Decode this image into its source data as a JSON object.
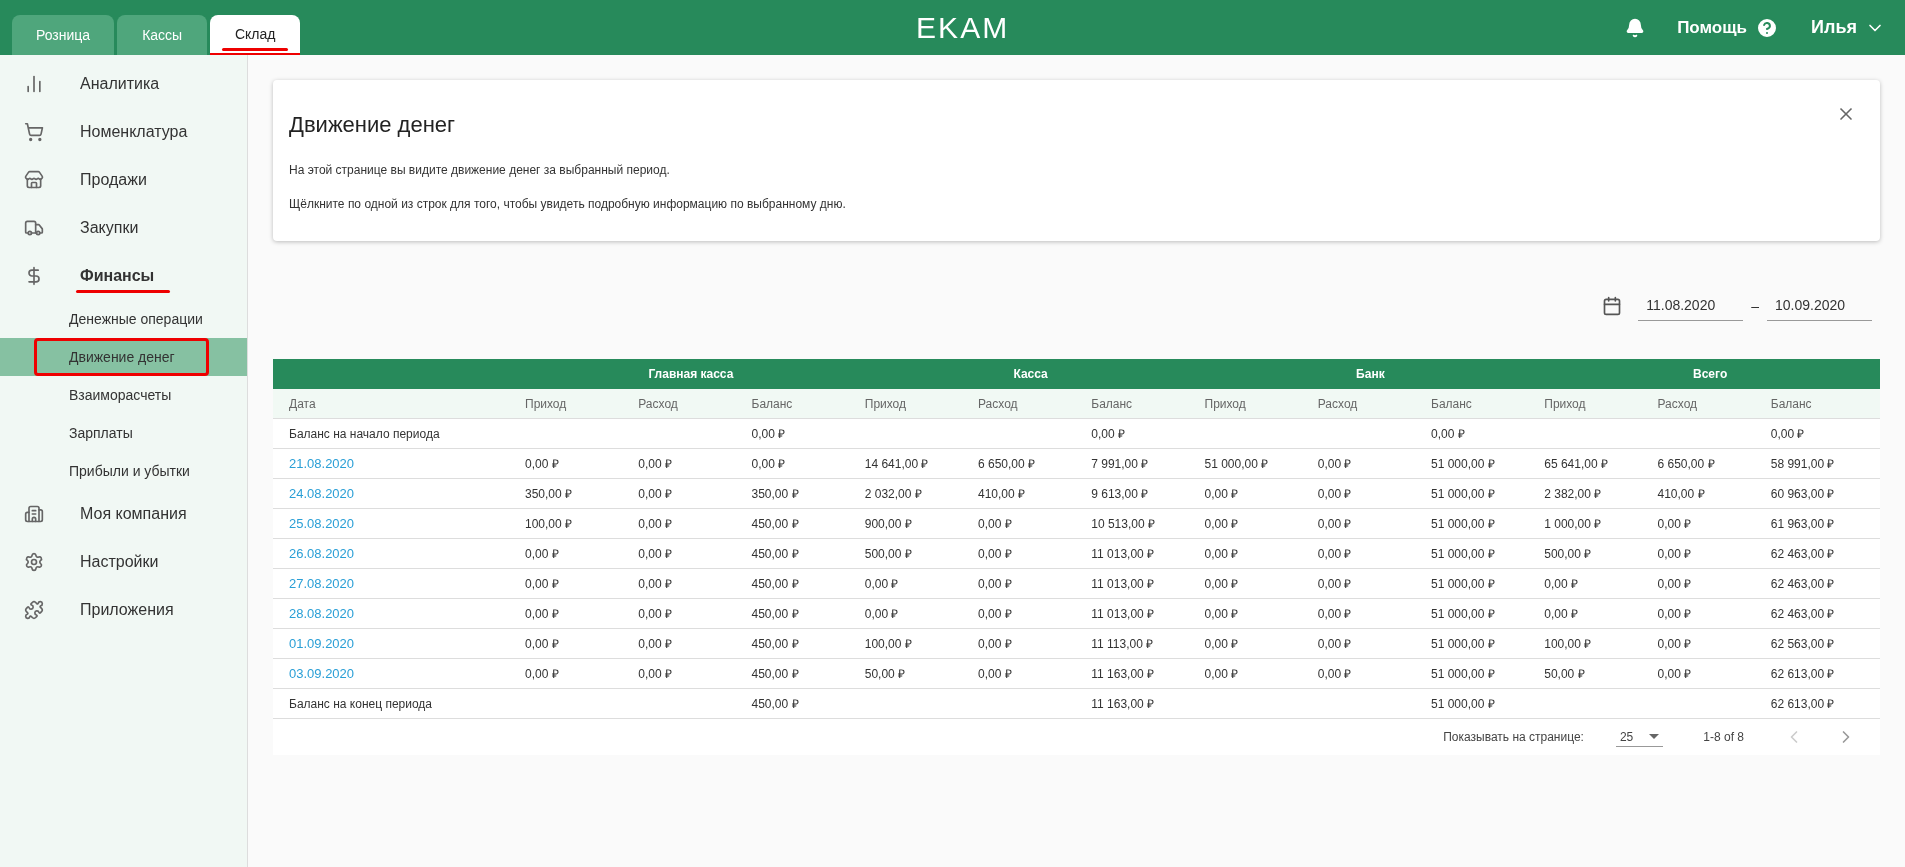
{
  "topbar": {
    "tabs": [
      {
        "label": "Розница",
        "selected": false,
        "annotated": false
      },
      {
        "label": "Кассы",
        "selected": false,
        "annotated": false
      },
      {
        "label": "Склад",
        "selected": true,
        "annotated": true
      }
    ],
    "logo": "EKAM",
    "help": "Помощь",
    "user": "Илья"
  },
  "sidebar": {
    "items": [
      {
        "label": "Аналитика",
        "expanded": false,
        "annotated": false
      },
      {
        "label": "Номенклатура",
        "expanded": false,
        "annotated": false
      },
      {
        "label": "Продажи",
        "expanded": false,
        "annotated": false
      },
      {
        "label": "Закупки",
        "expanded": false,
        "annotated": false
      },
      {
        "label": "Финансы",
        "expanded": true,
        "annotated": true,
        "children": [
          {
            "label": "Денежные операции",
            "selected": false,
            "annotated": false
          },
          {
            "label": "Движение денег",
            "selected": true,
            "annotated": true
          },
          {
            "label": "Взаиморасчеты",
            "selected": false,
            "annotated": false
          },
          {
            "label": "Зарплаты",
            "selected": false,
            "annotated": false
          },
          {
            "label": "Прибыли и убытки",
            "selected": false,
            "annotated": false
          }
        ]
      },
      {
        "label": "Моя компания",
        "expanded": false,
        "annotated": false
      },
      {
        "label": "Настройки",
        "expanded": false,
        "annotated": false
      },
      {
        "label": "Приложения",
        "expanded": false,
        "annotated": false
      }
    ]
  },
  "info_card": {
    "title": "Движение денег",
    "lines": [
      "На этой странице вы видите движение денег за выбранный период.",
      "Щёлкните по одной из строк для того, чтобы увидеть подробную информацию по выбранному дню."
    ]
  },
  "date_range": {
    "from": "11.08.2020",
    "separator": "–",
    "to": "10.09.2020"
  },
  "table": {
    "groups": [
      "Главная касса",
      "Касса",
      "Банк",
      "Всего"
    ],
    "columns": [
      "Дата",
      "Приход",
      "Расход",
      "Баланс",
      "Приход",
      "Расход",
      "Баланс",
      "Приход",
      "Расход",
      "Баланс",
      "Приход",
      "Расход",
      "Баланс"
    ],
    "rows": [
      {
        "kind": "balance",
        "cells": [
          "Баланс на начало периода",
          null,
          null,
          "0,00 ₽",
          null,
          null,
          "0,00 ₽",
          null,
          null,
          "0,00 ₽",
          null,
          null,
          "0,00 ₽"
        ]
      },
      {
        "kind": "day",
        "cells": [
          "21.08.2020",
          "0,00 ₽",
          "0,00 ₽",
          "0,00 ₽",
          "14 641,00 ₽",
          "6 650,00 ₽",
          "7 991,00 ₽",
          "51 000,00 ₽",
          "0,00 ₽",
          "51 000,00 ₽",
          "65 641,00 ₽",
          "6 650,00 ₽",
          "58 991,00 ₽"
        ]
      },
      {
        "kind": "day",
        "cells": [
          "24.08.2020",
          "350,00 ₽",
          "0,00 ₽",
          "350,00 ₽",
          "2 032,00 ₽",
          "410,00 ₽",
          "9 613,00 ₽",
          "0,00 ₽",
          "0,00 ₽",
          "51 000,00 ₽",
          "2 382,00 ₽",
          "410,00 ₽",
          "60 963,00 ₽"
        ]
      },
      {
        "kind": "day",
        "cells": [
          "25.08.2020",
          "100,00 ₽",
          "0,00 ₽",
          "450,00 ₽",
          "900,00 ₽",
          "0,00 ₽",
          "10 513,00 ₽",
          "0,00 ₽",
          "0,00 ₽",
          "51 000,00 ₽",
          "1 000,00 ₽",
          "0,00 ₽",
          "61 963,00 ₽"
        ]
      },
      {
        "kind": "day",
        "cells": [
          "26.08.2020",
          "0,00 ₽",
          "0,00 ₽",
          "450,00 ₽",
          "500,00 ₽",
          "0,00 ₽",
          "11 013,00 ₽",
          "0,00 ₽",
          "0,00 ₽",
          "51 000,00 ₽",
          "500,00 ₽",
          "0,00 ₽",
          "62 463,00 ₽"
        ]
      },
      {
        "kind": "day",
        "cells": [
          "27.08.2020",
          "0,00 ₽",
          "0,00 ₽",
          "450,00 ₽",
          "0,00 ₽",
          "0,00 ₽",
          "11 013,00 ₽",
          "0,00 ₽",
          "0,00 ₽",
          "51 000,00 ₽",
          "0,00 ₽",
          "0,00 ₽",
          "62 463,00 ₽"
        ]
      },
      {
        "kind": "day",
        "cells": [
          "28.08.2020",
          "0,00 ₽",
          "0,00 ₽",
          "450,00 ₽",
          "0,00 ₽",
          "0,00 ₽",
          "11 013,00 ₽",
          "0,00 ₽",
          "0,00 ₽",
          "51 000,00 ₽",
          "0,00 ₽",
          "0,00 ₽",
          "62 463,00 ₽"
        ]
      },
      {
        "kind": "day",
        "cells": [
          "01.09.2020",
          "0,00 ₽",
          "0,00 ₽",
          "450,00 ₽",
          "100,00 ₽",
          "0,00 ₽",
          "11 113,00 ₽",
          "0,00 ₽",
          "0,00 ₽",
          "51 000,00 ₽",
          "100,00 ₽",
          "0,00 ₽",
          "62 563,00 ₽"
        ]
      },
      {
        "kind": "day",
        "cells": [
          "03.09.2020",
          "0,00 ₽",
          "0,00 ₽",
          "450,00 ₽",
          "50,00 ₽",
          "0,00 ₽",
          "11 163,00 ₽",
          "0,00 ₽",
          "0,00 ₽",
          "51 000,00 ₽",
          "50,00 ₽",
          "0,00 ₽",
          "62 613,00 ₽"
        ]
      },
      {
        "kind": "balance",
        "cells": [
          "Баланс на конец периода",
          null,
          null,
          "450,00 ₽",
          null,
          null,
          "11 163,00 ₽",
          null,
          null,
          "51 000,00 ₽",
          null,
          null,
          "62 613,00 ₽"
        ]
      }
    ]
  },
  "pagination": {
    "label": "Показывать на странице:",
    "page_size": "25",
    "range": "1-8 of 8",
    "prev_disabled": true,
    "next_disabled": false
  }
}
